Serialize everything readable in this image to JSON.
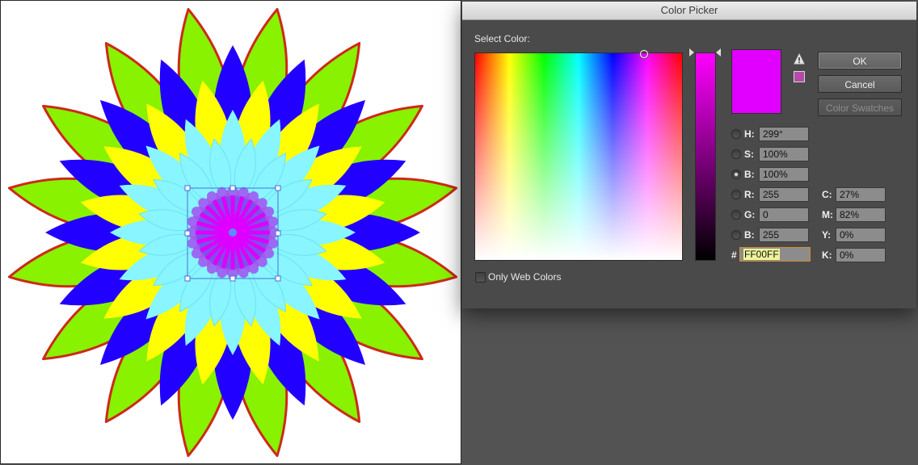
{
  "dialog": {
    "title": "Color Picker",
    "select_color_label": "Select Color:",
    "buttons": {
      "ok": "OK",
      "cancel": "Cancel",
      "color_swatches": "Color Swatches"
    },
    "only_web_colors_label": "Only Web Colors",
    "hsb": [
      {
        "label": "H:",
        "value": "299°",
        "selected": false
      },
      {
        "label": "S:",
        "value": "100%",
        "selected": false
      },
      {
        "label": "B:",
        "value": "100%",
        "selected": true
      }
    ],
    "rgb": [
      {
        "label": "R:",
        "value": "255"
      },
      {
        "label": "G:",
        "value": "0"
      },
      {
        "label": "B:",
        "value": "255"
      }
    ],
    "cmyk": [
      {
        "label": "C:",
        "value": "27%"
      },
      {
        "label": "M:",
        "value": "82%"
      },
      {
        "label": "Y:",
        "value": "0%"
      },
      {
        "label": "K:",
        "value": "0%"
      }
    ],
    "hex_label": "#",
    "hex_value": "FF00FF",
    "new_color": "#e100ff",
    "gamut_color": "#b54aa8",
    "warning_icon": "gamut-warning-icon"
  },
  "artwork": {
    "petal_colors": {
      "outer": "#88f200",
      "blue": "#2200ff",
      "yellow": "#ffff00",
      "cyan": "#88f5ff",
      "center": "#dd00ff",
      "stroke": "#cc2a1a"
    }
  }
}
